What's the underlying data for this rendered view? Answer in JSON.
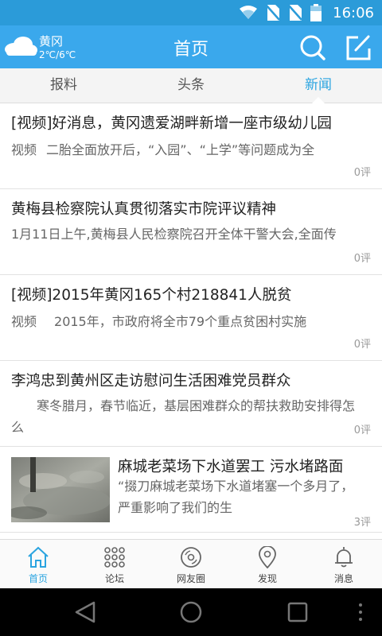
{
  "status": {
    "time": "16:06"
  },
  "header": {
    "weather": {
      "city": "黄冈",
      "temp": "2℃/6℃"
    },
    "title": "首页"
  },
  "tabs": [
    {
      "label": "报料",
      "active": false
    },
    {
      "label": "头条",
      "active": false
    },
    {
      "label": "新闻",
      "active": true
    }
  ],
  "news": [
    {
      "title": "[视频]好消息，黄冈遗爱湖畔新增一座市级幼儿园",
      "tag": "视频",
      "summary": "二胎全面放开后，“入园”、“上学”等问题成为全",
      "comments": "0评"
    },
    {
      "title": "黄梅县检察院认真贯彻落实市院评议精神",
      "tag": "",
      "summary": "1月11日上午,黄梅县人民检察院召开全体干警大会,全面传",
      "comments": "0评"
    },
    {
      "title": "[视频]2015年黄冈165个村218841人脱贫",
      "tag": "视频",
      "summary": "2015年，市政府将全市79个重点贫困村实施",
      "comments": "0评"
    },
    {
      "title": "李鸿忠到黄州区走访慰问生活困难党员群众",
      "tag": "",
      "summary": "　　寒冬腊月，春节临近，基层困难群众的帮扶救助安排得怎么",
      "comments": "0评"
    },
    {
      "title": "麻城老菜场下水道罢工 污水堵路面",
      "tag": "",
      "summary": "“掇刀麻城老菜场下水道堵塞一个多月了，严重影响了我们的生",
      "comments": "3评"
    }
  ],
  "bottom_nav": [
    {
      "label": "首页",
      "icon": "home-icon",
      "active": true
    },
    {
      "label": "论坛",
      "icon": "forum-grid-icon",
      "active": false
    },
    {
      "label": "网友圈",
      "icon": "disc-icon",
      "active": false
    },
    {
      "label": "发现",
      "icon": "location-pin-icon",
      "active": false
    },
    {
      "label": "消息",
      "icon": "bell-icon",
      "active": false
    }
  ],
  "colors": {
    "accent": "#3aa8ec",
    "active_tab": "#2aa4e0",
    "status_bar": "#2b9bd9"
  }
}
